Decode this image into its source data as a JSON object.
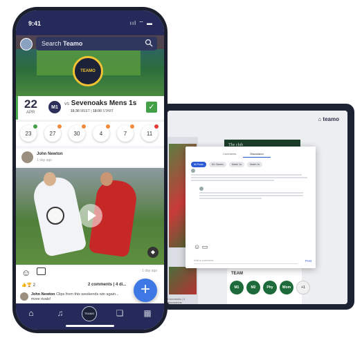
{
  "phone": {
    "status": {
      "time": "9:41",
      "icons": "ııl ⌔ ▬"
    },
    "search": {
      "prefix": "Search",
      "team": "Teamo"
    },
    "match": {
      "day": "22",
      "month": "APR",
      "team_badge": "M1",
      "vs": "vs",
      "opponent": "Sevenoaks Mens 1s",
      "meet_time": "16:30",
      "meet_label": "MEET",
      "start_time": "18:00",
      "start_label": "START"
    },
    "availability": [
      {
        "value": "23",
        "dot": "#43a047"
      },
      {
        "value": "27",
        "dot": "#f08a3a"
      },
      {
        "value": "30",
        "dot": "#f08a3a"
      },
      {
        "value": "4",
        "dot": "#f08a3a"
      },
      {
        "value": "7",
        "dot": "#f08a3a"
      },
      {
        "value": "11",
        "dot": "#e53935"
      }
    ],
    "post": {
      "author": "John Newton",
      "time": "1 day ago",
      "ago_right": "1 day ago",
      "reactions": "👍🏆 2",
      "comments": "2 comments | 4 di...",
      "comment_author": "John Newton",
      "comment_text": "Clips from this weekends win again... more rivals!"
    },
    "fab_label": "+",
    "nav": [
      "home",
      "bell",
      "logo",
      "chat",
      "calendar"
    ]
  },
  "laptop": {
    "logo": "⌂ teamo",
    "club_title": "The club",
    "caption": "Comments | 4 discussions",
    "team_title": "TEAM",
    "chips": [
      "M1",
      "M2",
      "Phy",
      "Wom",
      "+1"
    ],
    "dialog": {
      "tabs": [
        "Comments",
        "Discussion"
      ],
      "pills": [
        "All Posts",
        "M1 Games",
        "Match 1s",
        "Match 2s"
      ],
      "input_placeholder": "Add a comment...",
      "post_label": "Post"
    }
  },
  "colors": {
    "nav_bg": "#252a5a",
    "accent_green": "#43a047",
    "fab_blue": "#3d78e5",
    "badge_gold": "#f1c232"
  }
}
